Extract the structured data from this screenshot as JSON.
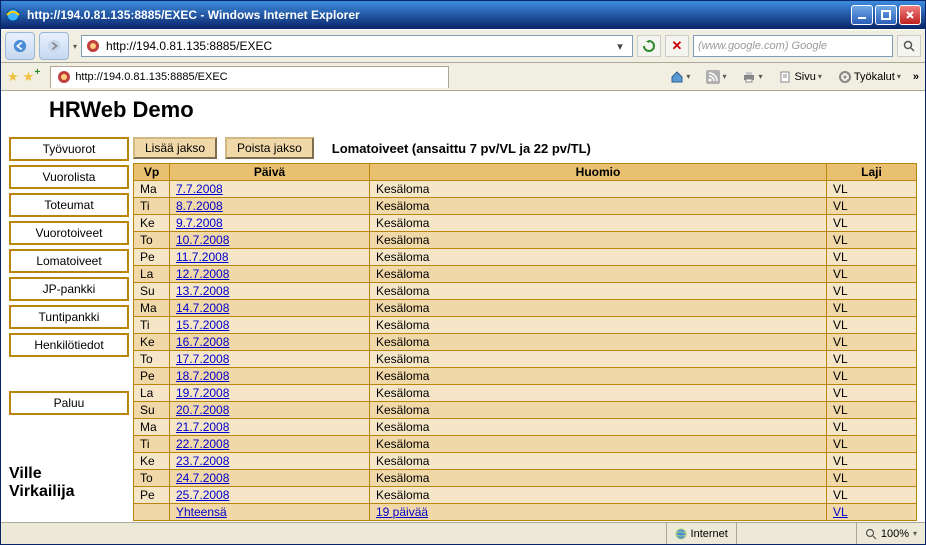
{
  "window": {
    "title": "http://194.0.81.135:8885/EXEC - Windows Internet Explorer"
  },
  "address_bar": {
    "url": "http://194.0.81.135:8885/EXEC"
  },
  "search": {
    "placeholder": "(www.google.com) Google"
  },
  "tab": {
    "label": "http://194.0.81.135:8885/EXEC"
  },
  "menu": {
    "page": "Sivu",
    "tools": "Työkalut"
  },
  "app": {
    "title": "HRWeb Demo",
    "user": "Ville Virkailija"
  },
  "sidebar": {
    "items": [
      "Työvuorot",
      "Vuorolista",
      "Toteumat",
      "Vuorotoiveet",
      "Lomatoiveet",
      "JP-pankki",
      "Tuntipankki",
      "Henkilötiedot"
    ],
    "back": "Paluu"
  },
  "actions": {
    "add": "Lisää jakso",
    "del": "Poista jakso",
    "heading": "Lomatoiveet (ansaittu 7 pv/VL ja 22 pv/TL)"
  },
  "table": {
    "headers": {
      "vp": "Vp",
      "date": "Päivä",
      "note": "Huomio",
      "type": "Laji"
    },
    "rows": [
      {
        "vp": "Ma",
        "date": "7.7.2008",
        "note": "Kesäloma",
        "type": "VL"
      },
      {
        "vp": "Ti",
        "date": "8.7.2008",
        "note": "Kesäloma",
        "type": "VL"
      },
      {
        "vp": "Ke",
        "date": "9.7.2008",
        "note": "Kesäloma",
        "type": "VL"
      },
      {
        "vp": "To",
        "date": "10.7.2008",
        "note": "Kesäloma",
        "type": "VL"
      },
      {
        "vp": "Pe",
        "date": "11.7.2008",
        "note": "Kesäloma",
        "type": "VL"
      },
      {
        "vp": "La",
        "date": "12.7.2008",
        "note": "Kesäloma",
        "type": "VL"
      },
      {
        "vp": "Su",
        "date": "13.7.2008",
        "note": "Kesäloma",
        "type": "VL"
      },
      {
        "vp": "Ma",
        "date": "14.7.2008",
        "note": "Kesäloma",
        "type": "VL"
      },
      {
        "vp": "Ti",
        "date": "15.7.2008",
        "note": "Kesäloma",
        "type": "VL"
      },
      {
        "vp": "Ke",
        "date": "16.7.2008",
        "note": "Kesäloma",
        "type": "VL"
      },
      {
        "vp": "To",
        "date": "17.7.2008",
        "note": "Kesäloma",
        "type": "VL"
      },
      {
        "vp": "Pe",
        "date": "18.7.2008",
        "note": "Kesäloma",
        "type": "VL"
      },
      {
        "vp": "La",
        "date": "19.7.2008",
        "note": "Kesäloma",
        "type": "VL"
      },
      {
        "vp": "Su",
        "date": "20.7.2008",
        "note": "Kesäloma",
        "type": "VL"
      },
      {
        "vp": "Ma",
        "date": "21.7.2008",
        "note": "Kesäloma",
        "type": "VL"
      },
      {
        "vp": "Ti",
        "date": "22.7.2008",
        "note": "Kesäloma",
        "type": "VL"
      },
      {
        "vp": "Ke",
        "date": "23.7.2008",
        "note": "Kesäloma",
        "type": "VL"
      },
      {
        "vp": "To",
        "date": "24.7.2008",
        "note": "Kesäloma",
        "type": "VL"
      },
      {
        "vp": "Pe",
        "date": "25.7.2008",
        "note": "Kesäloma",
        "type": "VL"
      }
    ],
    "total": {
      "label": "Yhteensä",
      "days": "19 päivää",
      "type": "VL"
    }
  },
  "status": {
    "zone": "Internet",
    "zoom": "100%"
  }
}
